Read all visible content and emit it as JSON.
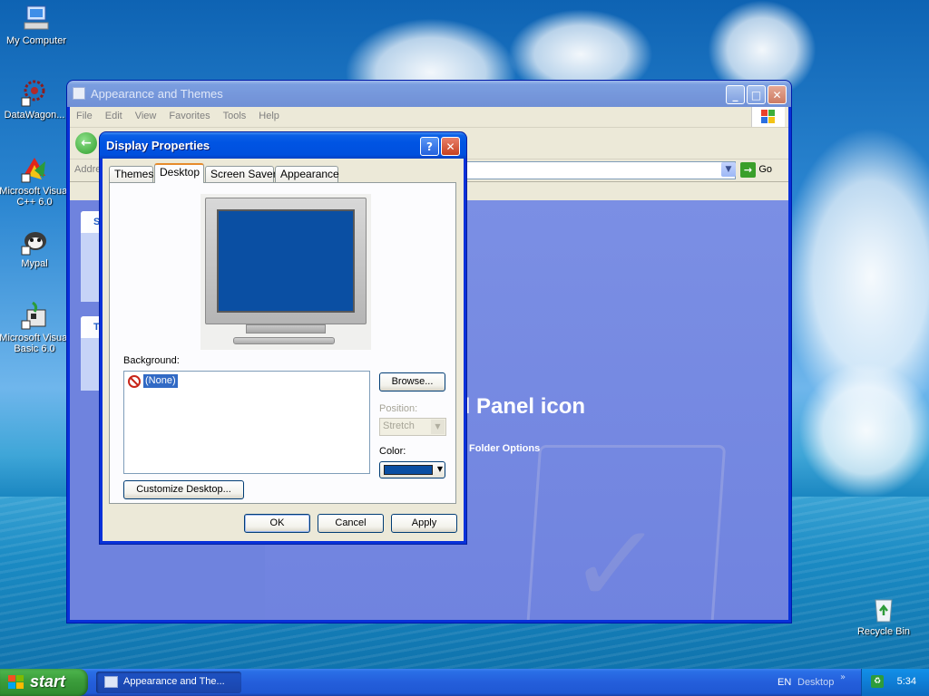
{
  "desktop": {
    "icons": [
      {
        "label": "My Computer",
        "icon": "computer-icon"
      },
      {
        "label": "DataWagon...",
        "icon": "datawagon-icon"
      },
      {
        "label": "Microsoft Visual C++ 6.0",
        "icon": "visual-cpp-icon"
      },
      {
        "label": "Mypal",
        "icon": "mypal-icon"
      },
      {
        "label": "Microsoft Visual Basic 6.0",
        "icon": "visual-basic-icon"
      },
      {
        "label": "Recycle Bin",
        "icon": "recycle-bin-icon"
      }
    ]
  },
  "explorer": {
    "title": "Appearance and Themes",
    "menu": [
      "File",
      "Edit",
      "View",
      "Favorites",
      "Tools",
      "Help"
    ],
    "address_label": "Addre",
    "go_label": "Go",
    "content_heading": "ol Panel icon",
    "folder_options": "Folder Options",
    "left_headers": [
      "S",
      "T"
    ]
  },
  "dialog": {
    "title": "Display Properties",
    "tabs": [
      "Themes",
      "Desktop",
      "Screen Saver",
      "Appearance"
    ],
    "active_tab": "Desktop",
    "background_label": "Background:",
    "background_items": [
      "(None)"
    ],
    "selected_background": "(None)",
    "browse_label": "Browse...",
    "position_label": "Position:",
    "position_value": "Stretch",
    "color_label": "Color:",
    "color_value": "#0a4fa3",
    "customize_label": "Customize Desktop...",
    "ok_label": "OK",
    "cancel_label": "Cancel",
    "apply_label": "Apply",
    "help_button": "?",
    "close_button": "✕"
  },
  "taskbar": {
    "start_label": "start",
    "task_label": "Appearance and The...",
    "language": "EN",
    "desktop_toolbar": "Desktop",
    "chevron": "»",
    "clock": "5:34"
  },
  "colors": {
    "titlebar_active": "#0054e3",
    "titlebar_inactive": "#7596da",
    "dialog_face": "#ece9d8",
    "selection": "#316ac5",
    "tab_highlight": "#e68b2c",
    "start_green": "#3c9e3c",
    "taskbar_blue": "#245edb"
  }
}
